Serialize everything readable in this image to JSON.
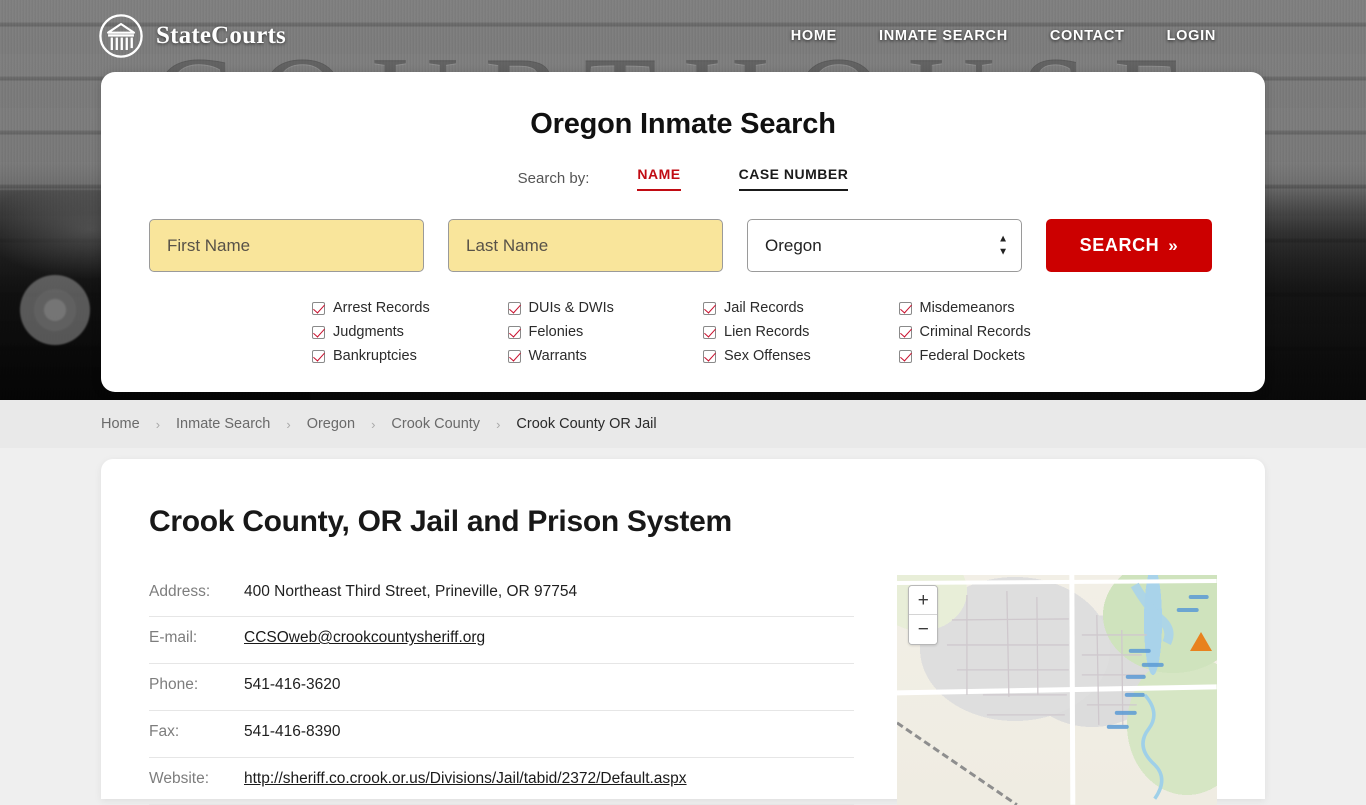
{
  "brand": {
    "name": "StateCourts",
    "logo_icon": "courthouse-circle-icon"
  },
  "nav": [
    {
      "label": "HOME"
    },
    {
      "label": "INMATE SEARCH"
    },
    {
      "label": "CONTACT"
    },
    {
      "label": "LOGIN"
    }
  ],
  "hero": {
    "watermark": "COURTHOUSE"
  },
  "search": {
    "title": "Oregon Inmate Search",
    "search_by_label": "Search by:",
    "tabs": [
      {
        "label": "NAME",
        "active": true
      },
      {
        "label": "CASE NUMBER",
        "active": false
      }
    ],
    "first_name_placeholder": "First Name",
    "first_name_value": "",
    "last_name_placeholder": "Last Name",
    "last_name_value": "",
    "state_selected": "Oregon",
    "state_options": [
      "Oregon"
    ],
    "button_label": "SEARCH",
    "button_chevron": "»",
    "accent_red": "#cc0000",
    "field_yellow": "#f9e59b"
  },
  "record_types": [
    "Arrest Records",
    "DUIs & DWIs",
    "Jail Records",
    "Misdemeanors",
    "Judgments",
    "Felonies",
    "Lien Records",
    "Criminal Records",
    "Bankruptcies",
    "Warrants",
    "Sex Offenses",
    "Federal Dockets"
  ],
  "breadcrumb": {
    "separator": "›",
    "items": [
      {
        "label": "Home",
        "current": false
      },
      {
        "label": "Inmate Search",
        "current": false
      },
      {
        "label": "Oregon",
        "current": false
      },
      {
        "label": "Crook County",
        "current": false
      },
      {
        "label": "Crook County OR Jail",
        "current": true
      }
    ]
  },
  "page": {
    "title": "Crook County, OR Jail and Prison System",
    "details": [
      {
        "key": "Address:",
        "value": "400 Northeast Third Street, Prineville, OR 97754",
        "link": false
      },
      {
        "key": "E-mail:",
        "value": "CCSOweb@crookcountysheriff.org",
        "link": true
      },
      {
        "key": "Phone:",
        "value": "541-416-3620",
        "link": false
      },
      {
        "key": "Fax:",
        "value": "541-416-8390",
        "link": false
      },
      {
        "key": "Website:",
        "value": "http://sheriff.co.crook.or.us/Divisions/Jail/tabid/2372/Default.aspx",
        "link": true
      }
    ]
  },
  "map": {
    "zoom_in_label": "+",
    "zoom_out_label": "−"
  }
}
